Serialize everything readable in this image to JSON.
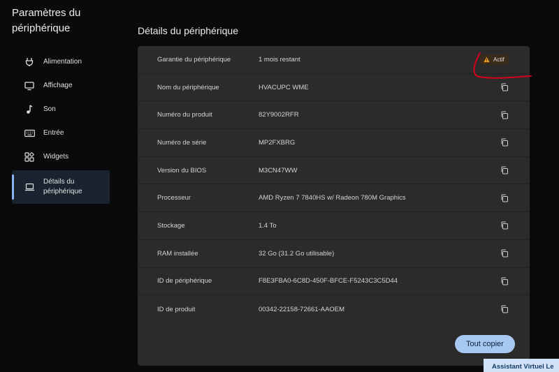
{
  "app": {
    "title": "Paramètres du périphérique"
  },
  "sidebar": {
    "items": [
      {
        "label": "Alimentation",
        "icon": "plug-icon"
      },
      {
        "label": "Affichage",
        "icon": "monitor-icon"
      },
      {
        "label": "Son",
        "icon": "music-note-icon"
      },
      {
        "label": "Entrée",
        "icon": "keyboard-icon"
      },
      {
        "label": "Widgets",
        "icon": "widgets-icon"
      },
      {
        "label": "Détails du périphérique",
        "icon": "laptop-icon",
        "active": true
      }
    ]
  },
  "main": {
    "heading": "Détails du périphérique",
    "rows": [
      {
        "key": "Garantie du périphérique",
        "value": "1 mois restant",
        "badge": "Actif"
      },
      {
        "key": "Nom du périphérique",
        "value": "HVACUPC WME"
      },
      {
        "key": "Numéro du produit",
        "value": "82Y9002RFR"
      },
      {
        "key": "Numéro de série",
        "value": "MP2FXBRG"
      },
      {
        "key": "Version du BIOS",
        "value": "M3CN47WW"
      },
      {
        "key": "Processeur",
        "value": "AMD Ryzen 7 7840HS w/ Radeon 780M Graphics"
      },
      {
        "key": "Stockage",
        "value": "1.4 To"
      },
      {
        "key": "RAM installée",
        "value": "32 Go (31.2 Go utilisable)"
      },
      {
        "key": "ID de périphérique",
        "value": "F8E3FBA0-6C8D-450F-BFCE-F5243C3C5D44"
      },
      {
        "key": "ID de produit",
        "value": "00342-22158-72661-AAOEM"
      }
    ],
    "copy_all_label": "Tout copier"
  },
  "overlay": {
    "assistant_label": "Assistant Virtuel Le"
  },
  "colors": {
    "accent": "#8ab4f8",
    "button_bg": "#a8c8f4",
    "annotation": "#d6001c",
    "warning": "#f0a020"
  }
}
